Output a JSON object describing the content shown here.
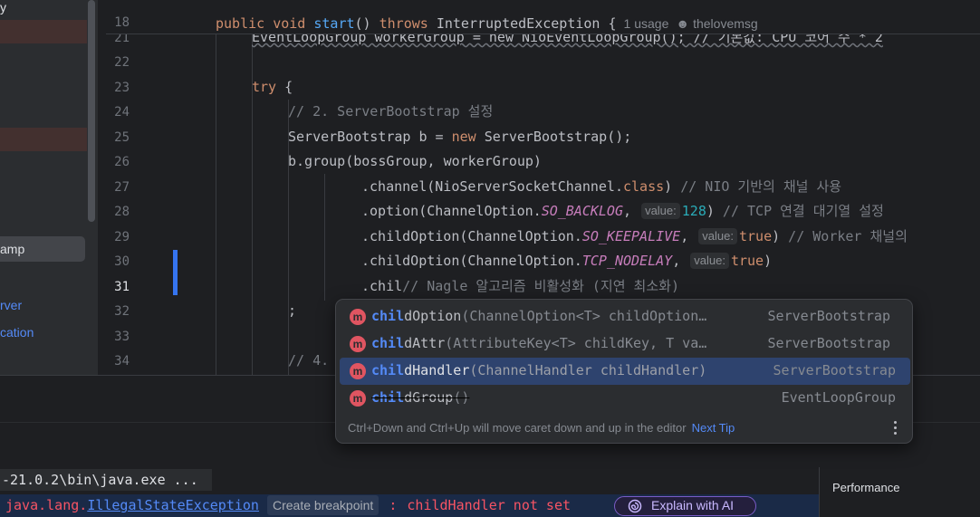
{
  "project_tree": {
    "item_top": "y",
    "selected_item": "amp",
    "link_items": [
      "rver",
      "cation"
    ]
  },
  "editor": {
    "sticky_line_number": "18",
    "sticky_code": {
      "kw1": "public",
      "kw2": "void",
      "method": "start",
      "params": "()",
      "kw3": "throws",
      "exception": "InterruptedException",
      "brace": "{",
      "usages": "1 usage",
      "author": "thelovemsg"
    },
    "lines": [
      {
        "num": "21",
        "text": "EventLoopGroup workerGroup = new NioEventLoopGroup(); // 기본값: CPU 코어 수 * 2"
      },
      {
        "num": "22",
        "text": ""
      },
      {
        "num": "23",
        "kw": "try",
        "rest": " {"
      },
      {
        "num": "24",
        "comment": "// 2. ServerBootstrap 설정"
      },
      {
        "num": "25",
        "a": "ServerBootstrap b = ",
        "kw": "new",
        "b": " ServerBootstrap();"
      },
      {
        "num": "26",
        "text": "b.group(bossGroup, workerGroup)"
      },
      {
        "num": "27",
        "a": ".channel(NioServerSocketChannel.",
        "kw": "class",
        "b": ") ",
        "comment": "// NIO 기반의 채널 사용"
      },
      {
        "num": "28",
        "a": ".option(ChannelOption.",
        "static": "SO_BACKLOG",
        "b": ", ",
        "hint": "value:",
        "num_val": "128",
        "c": ") ",
        "comment": "// TCP 연결 대기열 설정"
      },
      {
        "num": "29",
        "a": ".childOption(ChannelOption.",
        "static": "SO_KEEPALIVE",
        "b": ", ",
        "hint": "value:",
        "kw": "true",
        "c": ") ",
        "comment": "// Worker 채널의"
      },
      {
        "num": "30",
        "a": ".childOption(ChannelOption.",
        "static": "TCP_NODELAY",
        "b": ", ",
        "hint": "value:",
        "kw": "true",
        "c": ")"
      },
      {
        "num": "31",
        "a": ".chil",
        "comment": "// Nagle 알고리즘 비활성화 (지연 최소화)"
      },
      {
        "num": "32",
        "text": ";"
      },
      {
        "num": "33",
        "text": ""
      },
      {
        "num": "34",
        "comment": "// 4."
      }
    ]
  },
  "completion_popup": {
    "prefix": "chil",
    "items": [
      {
        "rest": "dOption",
        "signature": "(ChannelOption<T> childOption…",
        "type": "ServerBootstrap",
        "selected": false,
        "deprecated": false
      },
      {
        "rest": "dAttr",
        "signature": "(AttributeKey<T> childKey, T va…",
        "type": "ServerBootstrap",
        "selected": false,
        "deprecated": false
      },
      {
        "rest": "dHandler",
        "signature": "(ChannelHandler childHandler)",
        "type": "ServerBootstrap",
        "selected": true,
        "deprecated": false
      },
      {
        "rest": "dGroup",
        "signature": "()",
        "type": "EventLoopGroup",
        "selected": false,
        "deprecated": true
      }
    ],
    "icon_letter": "m",
    "footer_text": "Ctrl+Down and Ctrl+Up will move caret down and up in the editor",
    "next_tip": "Next Tip"
  },
  "run_tab": {
    "label": "-21.0.2\\bin\\java.exe ..."
  },
  "error_bar": {
    "prefix": "java.lang.",
    "exception": "IllegalStateException",
    "breakpoint_button": "Create breakpoint",
    "separator": ":",
    "message": "childHandler not set",
    "ai_button": "Explain with AI"
  },
  "right_panel": {
    "title": "Performance"
  },
  "colors": {
    "accent": "#548af7",
    "error": "#f75464",
    "keyword": "#cf8e6d",
    "method_icon": "#e05561"
  }
}
